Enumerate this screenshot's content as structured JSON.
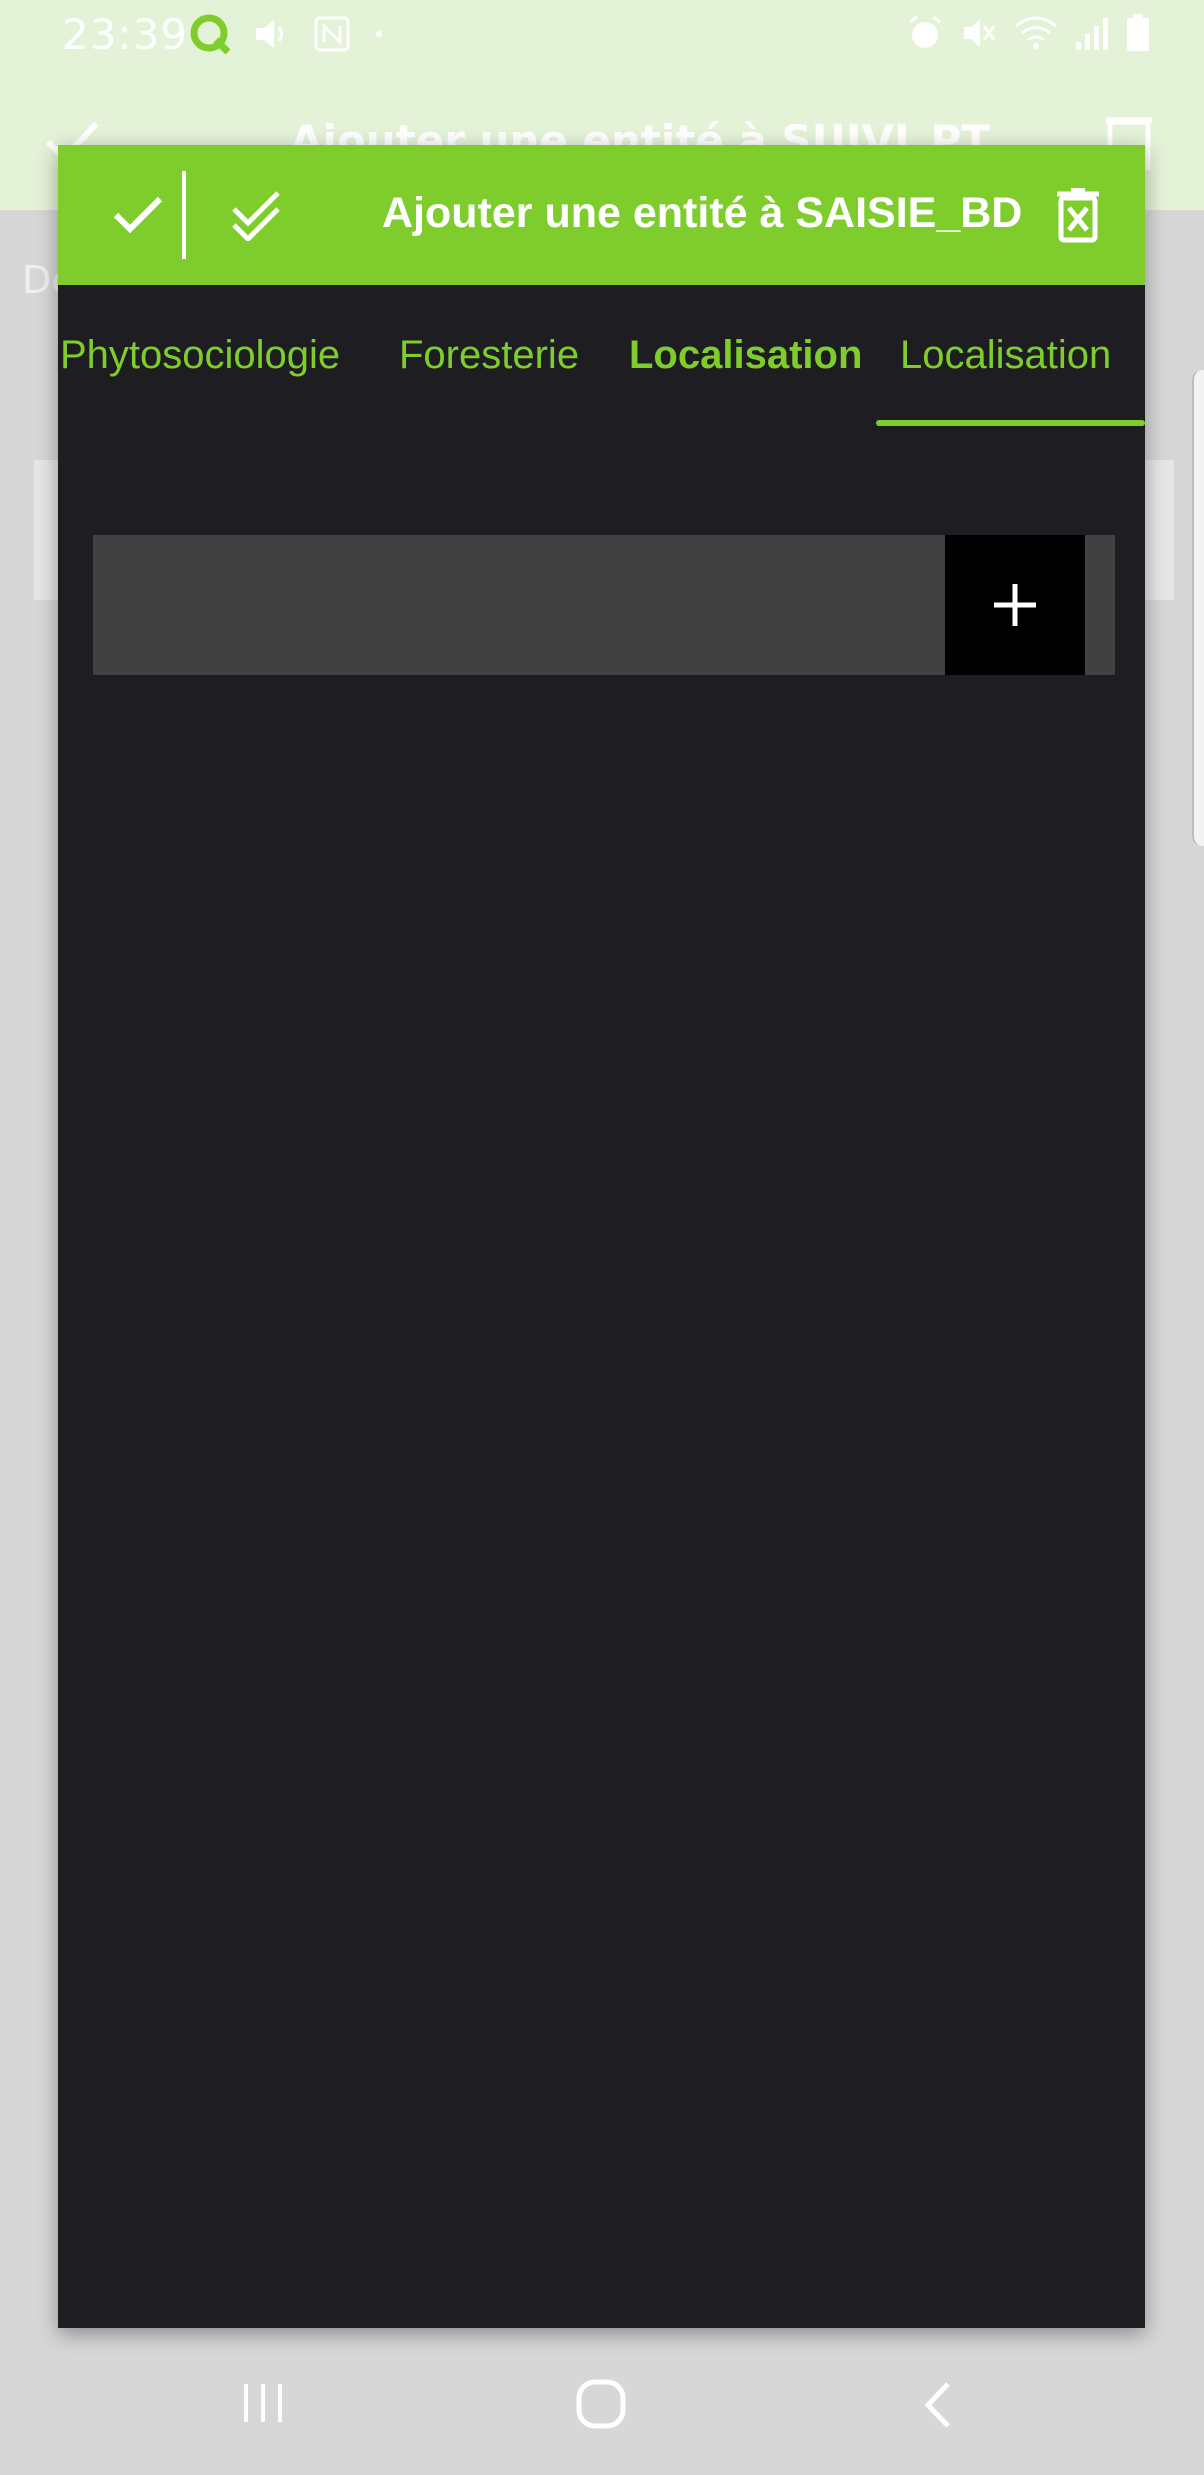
{
  "status_bar": {
    "time": "23:39",
    "left_icons": [
      "qfield-icon",
      "volume-icon",
      "nfc-icon",
      "dot-icon"
    ],
    "right_icons": [
      "alarm-icon",
      "mute-icon",
      "wifi-icon",
      "signal-icon",
      "battery-icon"
    ]
  },
  "background": {
    "title": "Ajouter une entité à SUIVI_PT",
    "side_text": "De"
  },
  "dialog": {
    "title": "Ajouter une entité à SAISIE_BD",
    "tabs": [
      {
        "label": "Phytosociologie",
        "bold": false,
        "active": false
      },
      {
        "label": "Foresterie",
        "bold": false,
        "active": false
      },
      {
        "label": "Localisation",
        "bold": true,
        "active": false
      },
      {
        "label": "Localisation",
        "bold": false,
        "active": true
      }
    ]
  },
  "colors": {
    "accent": "#7fcd2d",
    "dialog_bg": "#1e1d22",
    "field_bg": "#414141",
    "add_button_bg": "#000000"
  },
  "nav_bar": {
    "buttons": [
      "recents-icon",
      "home-icon",
      "back-icon"
    ]
  }
}
